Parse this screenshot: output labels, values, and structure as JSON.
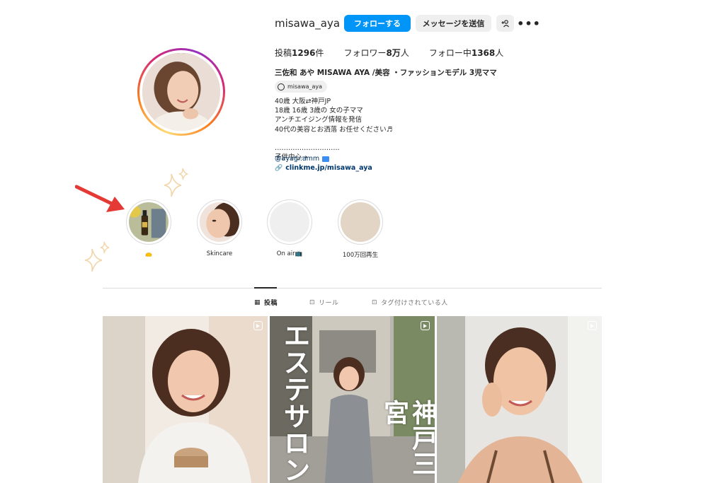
{
  "profile": {
    "username": "misawa_aya",
    "follow_label": "フォローする",
    "message_label": "メッセージを送信",
    "adduser_label": "+",
    "more_label": "•••"
  },
  "stats": {
    "posts_prefix": "投稿",
    "posts_value": "1296",
    "posts_suffix": "件",
    "followers_prefix": "フォロワー",
    "followers_value": "8万",
    "followers_suffix": "人",
    "following_prefix": "フォロー中",
    "following_value": "1368",
    "following_suffix": "人"
  },
  "bio": {
    "full_name": "三佐和 あや MISAWA AYA /美容 ・ファッションモデル 3児ママ",
    "threads_handle": "misawa_aya",
    "text": "40歳 大阪⇄神戸JP\n18歳 16歳 3歳の 女の子ママ\nアンチエイジング情報を発信\n40代の美容とお洒落 お任せください♬\n\n………………………..\n子供中心→",
    "mention": "@ayagr.amm",
    "link": "clinkme.jp/misawa_aya"
  },
  "highlights": [
    {
      "label": "👝"
    },
    {
      "label": "Skincare"
    },
    {
      "label": "On air📺"
    },
    {
      "label": "100万回再生"
    }
  ],
  "tabs": {
    "posts": "投稿",
    "reels": "リール",
    "tagged": "タグ付けされている人"
  },
  "posts": [
    {
      "overlay_left": "",
      "overlay_right": ""
    },
    {
      "overlay_left": "エステサロン",
      "overlay_right": "神戸三宮"
    },
    {
      "overlay_left": "",
      "overlay_right": ""
    }
  ],
  "colors": {
    "accent": "#0095f6",
    "link": "#00376b",
    "arrow": "#e53935",
    "sparkle": "#f2d5a8"
  }
}
